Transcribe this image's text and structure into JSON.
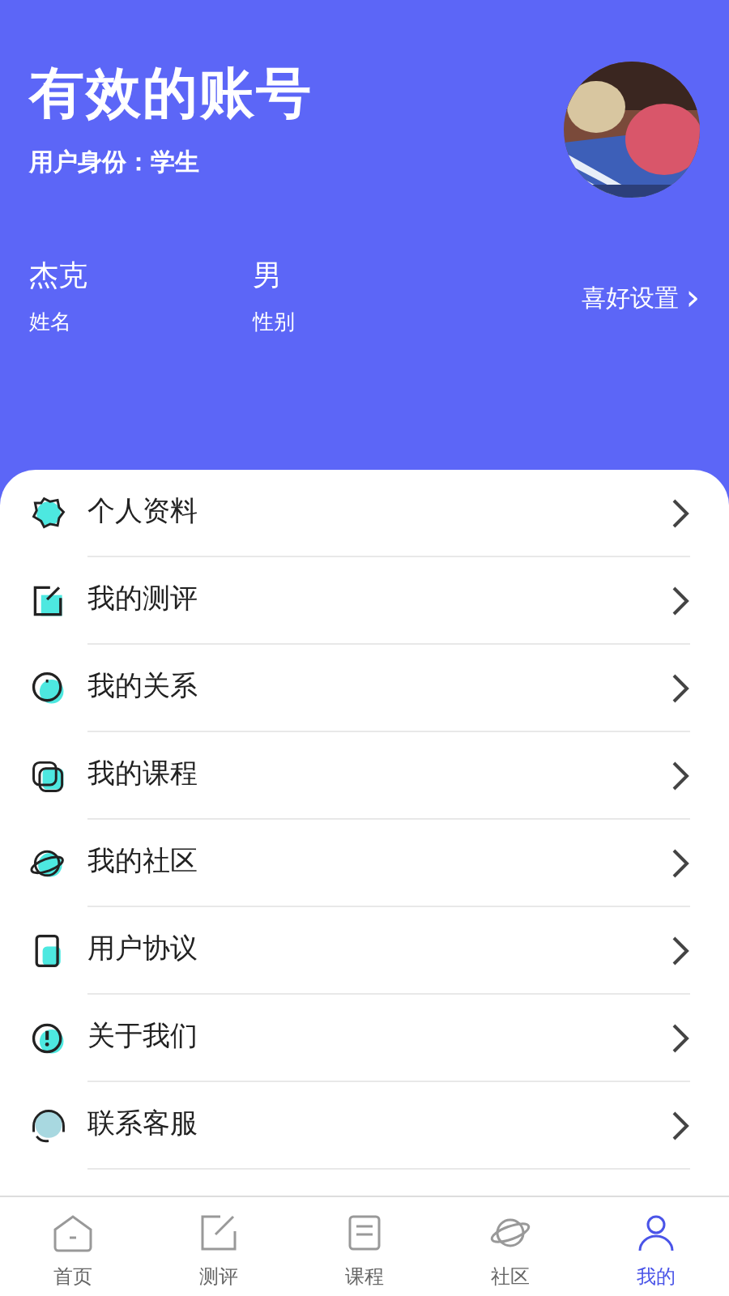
{
  "header": {
    "title": "有效的账号",
    "identity": "用户身份：学生",
    "fields": [
      {
        "value": "杰克",
        "label": "姓名"
      },
      {
        "value": "男",
        "label": "性别"
      }
    ],
    "preferences": {
      "label": "喜好设置",
      "chevron": "›"
    }
  },
  "menu": [
    {
      "label": "个人资料"
    },
    {
      "label": "我的测评"
    },
    {
      "label": "我的关系"
    },
    {
      "label": "我的课程"
    },
    {
      "label": "我的社区"
    },
    {
      "label": "用户协议"
    },
    {
      "label": "关于我们"
    },
    {
      "label": "联系客服"
    }
  ],
  "tabbar": [
    {
      "label": "首页",
      "selected": false
    },
    {
      "label": "测评",
      "selected": false
    },
    {
      "label": "课程",
      "selected": false
    },
    {
      "label": "社区",
      "selected": false
    },
    {
      "label": "我的",
      "selected": true
    }
  ]
}
